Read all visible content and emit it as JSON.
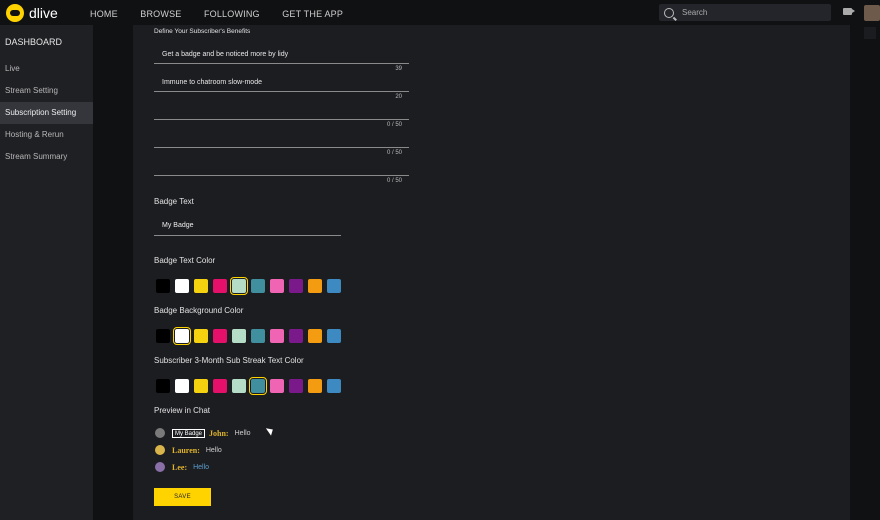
{
  "app": {
    "name": "dlive"
  },
  "nav": [
    "HOME",
    "BROWSE",
    "FOLLOWING",
    "GET THE APP"
  ],
  "search": {
    "placeholder": "Search"
  },
  "sidebar": {
    "heading": "DASHBOARD",
    "items": [
      {
        "label": "Live",
        "active": false
      },
      {
        "label": "Stream Setting",
        "active": false
      },
      {
        "label": "Subscription Setting",
        "active": true
      },
      {
        "label": "Hosting & Rerun",
        "active": false
      },
      {
        "label": "Stream Summary",
        "active": false
      }
    ]
  },
  "benefits": {
    "title": "Define Your Subscriber's Benefits",
    "items": [
      {
        "text": "Get a badge and be noticed more by lidy",
        "count": "39"
      },
      {
        "text": "Immune to chatroom slow-mode",
        "count": "20"
      },
      {
        "text": "",
        "count": "0 / 50"
      },
      {
        "text": "",
        "count": "0 / 50"
      },
      {
        "text": "",
        "count": "0 / 50"
      }
    ]
  },
  "badge_text": {
    "label": "Badge Text",
    "value": "My Badge"
  },
  "palette": [
    "#000000",
    "#ffffff",
    "#f5d20f",
    "#e5106a",
    "#b5dcc7",
    "#3f8f9f",
    "#f064b4",
    "#7a1a8a",
    "#f39c12",
    "#3d8ac2"
  ],
  "badge_text_color": {
    "label": "Badge Text Color",
    "selected_index": 4
  },
  "badge_bg_color": {
    "label": "Badge Background Color",
    "selected_index": 1
  },
  "streak_color": {
    "label": "Subscriber 3-Month Sub Streak Text Color",
    "selected_index": 5
  },
  "preview": {
    "label": "Preview in Chat",
    "rows": [
      {
        "badge": "My Badge",
        "name": "John:",
        "msg": "Hello",
        "avatar": "#7a7a7a"
      },
      {
        "badge": "",
        "name": "Lauren:",
        "msg": "Hello",
        "avatar": "#d8b44a"
      },
      {
        "badge": "",
        "name": "Lee:",
        "msg": "Hello",
        "avatar": "#8a6fa8"
      }
    ]
  },
  "save_label": "SAVE"
}
